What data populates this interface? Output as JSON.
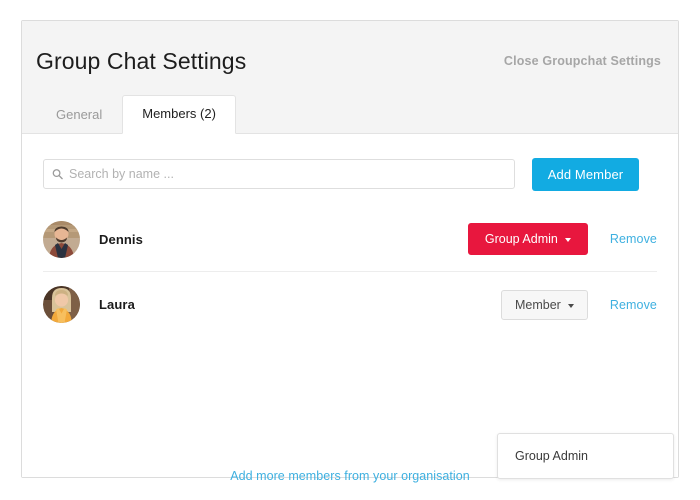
{
  "header": {
    "title": "Group Chat Settings",
    "close_label": "Close Groupchat Settings"
  },
  "tabs": [
    {
      "label": "General",
      "active": false
    },
    {
      "label": "Members (2)",
      "active": true
    }
  ],
  "toolbar": {
    "search_placeholder": "Search by name ...",
    "search_value": "",
    "search_icon": "search-icon",
    "add_member_label": "Add Member"
  },
  "members": [
    {
      "name": "Dennis",
      "avatar": "avatar-photo-dennis",
      "role_label": "Group Admin",
      "role_style": "admin",
      "remove_label": "Remove"
    },
    {
      "name": "Laura",
      "avatar": "avatar-photo-laura",
      "role_label": "Member",
      "role_style": "member",
      "remove_label": "Remove"
    }
  ],
  "role_dropdown": {
    "open": true,
    "options": [
      "Group Admin"
    ]
  },
  "footer": {
    "org_link_label": "Add more members from your organisation"
  },
  "colors": {
    "accent_blue": "#12abe2",
    "link_blue": "#3eb0e0",
    "admin_red": "#e8173e",
    "header_bg": "#f4f4f4",
    "card_border": "#dcdcdc",
    "muted_text": "#a6a6a6"
  }
}
